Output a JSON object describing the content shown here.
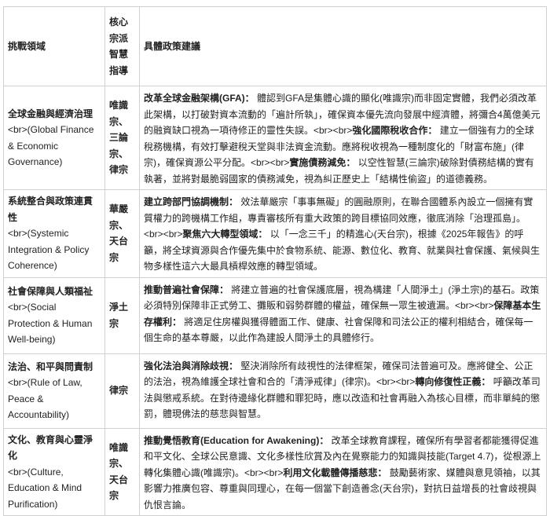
{
  "headers": [
    "挑戰領域",
    "核心宗派智慧指導",
    "具體政策建議"
  ],
  "rows": [
    {
      "area": "全球金融與經濟治理",
      "area_en": "<br>(Global Finance & Economic Governance)",
      "schools": "唯識宗、三論宗、律宗",
      "policy": [
        {
          "b": true,
          "t": "改革全球金融架構(GFA)："
        },
        {
          "b": false,
          "t": " 體認到GFA是集體心識的顯化(唯識宗)而非固定實體，我們必須改革此架構，以打破對資本流動的「遍計所執」，確保資本優先流向發展中經濟體，將彌合4萬億美元的融資缺口視為一項待修正的靈性失誤。<br><br>"
        },
        {
          "b": true,
          "t": "強化國際稅收合作："
        },
        {
          "b": false,
          "t": " 建立一個強有力的全球稅務機構，有效打擊避稅天堂與非法資金流動。應將稅收視為一種制度化的「財富布施」(律宗)，確保資源公平分配。<br><br>"
        },
        {
          "b": true,
          "t": "實施債務減免："
        },
        {
          "b": false,
          "t": " 以空性智慧(三論宗)破除對債務結構的實有執著，並將對最脆弱國家的債務減免，視為糾正歷史上「結構性偷盜」的道德義務。"
        }
      ]
    },
    {
      "area": "系統整合與政策連貫性",
      "area_en": "<br>(Systemic Integration & Policy Coherence)",
      "schools": "華嚴宗、天台宗",
      "policy": [
        {
          "b": true,
          "t": "建立跨部門協調機制："
        },
        {
          "b": false,
          "t": " 效法華嚴宗「事事無礙」的圓融原則，在聯合國體系內設立一個擁有實質權力的跨機構工作組，專責審核所有重大政策的跨目標協同效應，徹底消除「治理孤島」。<br><br>"
        },
        {
          "b": true,
          "t": "聚焦六大轉型領域："
        },
        {
          "b": false,
          "t": " 以「一念三千」的精進心(天台宗)，根據《2025年報告》的呼籲，將全球資源與合作優先集中於食物系統、能源、數位化、教育、就業與社會保護、氣候與生物多樣性這六大最具槓桿效應的轉型領域。"
        }
      ]
    },
    {
      "area": "社會保障與人類福祉",
      "area_en": "<br>(Social Protection & Human Well-being)",
      "schools": "淨土宗",
      "policy": [
        {
          "b": true,
          "t": "推動普遍社會保障："
        },
        {
          "b": false,
          "t": " 將建立普遍的社會保護底層，視為構建「人間淨土」(淨土宗)的基石。政策必須特別保障非正式勞工、攤販和弱勢群體的權益，確保無一眾生被遺漏。<br><br>"
        },
        {
          "b": true,
          "t": "保障基本生存權利："
        },
        {
          "b": false,
          "t": " 將適足住房權與獲得體面工作、健康、社會保障和司法公正的權利相結合，確保每一個生命的基本尊嚴，以此作為建設人間淨土的具體修行。"
        }
      ]
    },
    {
      "area": "法治、和平與問責制",
      "area_en": "<br>(Rule of Law, Peace & Accountability)",
      "schools": "律宗",
      "policy": [
        {
          "b": true,
          "t": "強化法治與消除歧視："
        },
        {
          "b": false,
          "t": " 堅決消除所有歧視性的法律框架，確保司法普遍可及。應將健全、公正的法治，視為維護全球社會和合的「清淨戒律」(律宗)。<br><br>"
        },
        {
          "b": true,
          "t": "轉向修復性正義："
        },
        {
          "b": false,
          "t": " 呼籲改革司法與懲戒系統。在對待邊緣化群體和罪犯時，應以改造和社會再融入為核心目標，而非單純的懲罰，體現佛法的慈悲與智慧。"
        }
      ]
    },
    {
      "area": "文化、教育與心靈淨化",
      "area_en": "<br>(Culture, Education & Mind Purification)",
      "schools": "唯識宗、天台宗",
      "policy": [
        {
          "b": true,
          "t": "推動覺悟教育(Education for Awakening)："
        },
        {
          "b": false,
          "t": " 改革全球教育課程，確保所有學習者都能獲得促進和平文化、全球公民意識、文化多樣性欣賞及內在覺察能力的知識與技能(Target 4.7)，從根源上轉化集體心識(唯識宗)。<br><br>"
        },
        {
          "b": true,
          "t": "利用文化載體傳播慈悲："
        },
        {
          "b": false,
          "t": " 鼓勵藝術家、媒體與意見領袖，以其影響力推廣包容、尊重與同理心，在每一個當下創造善念(天台宗)，對抗日益增長的社會歧視與仇恨言論。"
        }
      ]
    }
  ]
}
